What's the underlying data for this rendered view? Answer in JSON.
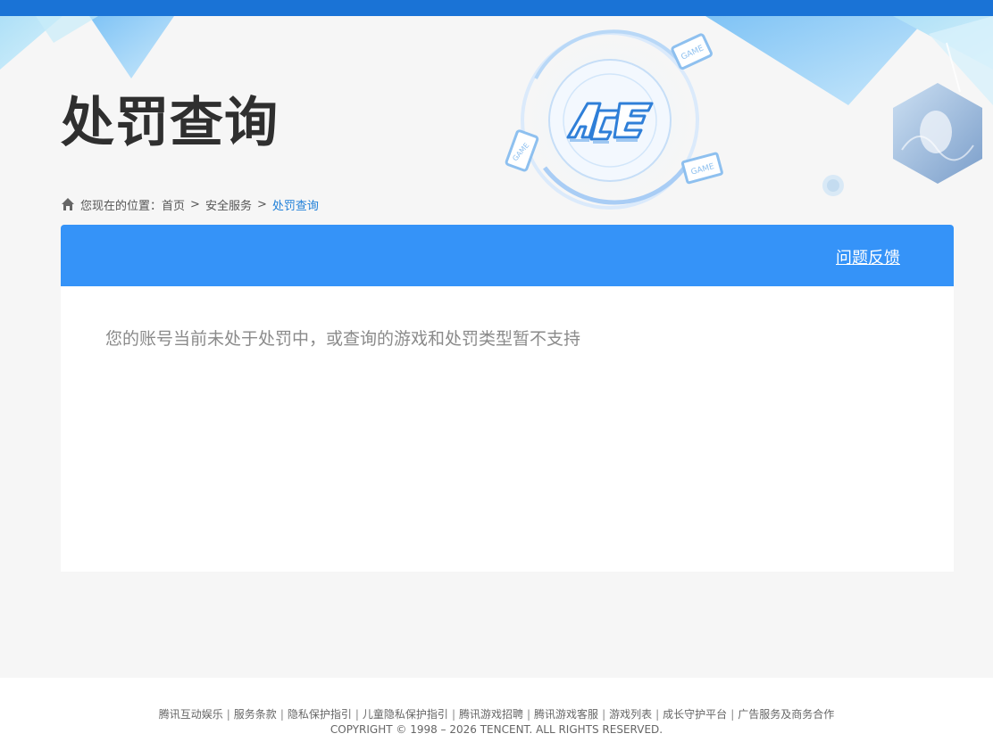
{
  "header": {
    "title": "处罚查询",
    "logo_text": "ACE",
    "game_badge": "GAME"
  },
  "breadcrumb": {
    "prefix": "您现在的位置：",
    "items": [
      "首页",
      "安全服务"
    ],
    "current": "处罚查询",
    "separator": ">"
  },
  "panel": {
    "feedback_label": "问题反馈",
    "message": "您的账号当前未处于处罚中，或查询的游戏和处罚类型暂不支持"
  },
  "footer": {
    "links": [
      "腾讯互动娱乐",
      "服务条款",
      "隐私保护指引",
      "儿童隐私保护指引",
      "腾讯游戏招聘",
      "腾讯游戏客服",
      "游戏列表",
      "成长守护平台",
      "广告服务及商务合作"
    ],
    "copyright": "COPYRIGHT © 1998 – 2026 TENCENT. ALL RIGHTS RESERVED."
  },
  "colors": {
    "top_bar": "#1a73d6",
    "panel_header": "#3593f8",
    "breadcrumb_current": "#1e7fd8",
    "title": "#2f2f2f"
  },
  "icons": {
    "home": "home-icon",
    "logo": "ace-logo",
    "decor": "game-device-icon"
  }
}
